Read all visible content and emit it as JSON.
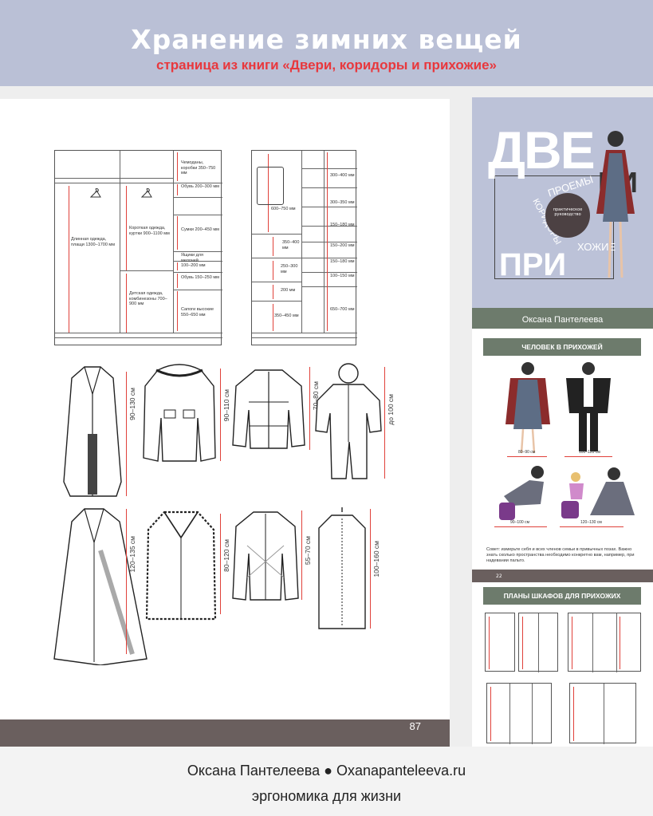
{
  "header": {
    "title": "Хранение зимних вещей",
    "subtitle": "страница из книги «Двери, коридоры и прихожие»"
  },
  "main_page": {
    "page_number": "87",
    "wardrobe_left": {
      "labels": [
        "Длинная одежда, плащи 1300–1700 мм",
        "Короткая одежда, куртки 900–1100 мм",
        "Детская одежда, комбинезоны 700–900 мм",
        "Чемоданы, коробки 350–750 мм",
        "Обувь 200–300 мм",
        "Сумки 200–450 мм",
        "Ящики для мелочей",
        "100–200 мм",
        "Обувь 150–250 мм",
        "Сапоги высокие 550–650 мм"
      ]
    },
    "wardrobe_right": {
      "labels": [
        "600–750 мм",
        "350–400 мм",
        "250–300 мм",
        "200 мм",
        "350–450 мм",
        "300–400 мм",
        "300–350 мм",
        "150–180 мм",
        "150–200 мм",
        "150–180 мм",
        "100–150 мм",
        "650–700 мм"
      ]
    },
    "garments": [
      {
        "name": "long-coat",
        "dimension": "90–130 см"
      },
      {
        "name": "parka",
        "dimension": "90–110 см"
      },
      {
        "name": "down-jacket",
        "dimension": "70–80 см"
      },
      {
        "name": "kids-overall",
        "dimension": "до 100 см"
      },
      {
        "name": "trench-coat",
        "dimension": "120–135 см"
      },
      {
        "name": "fur-coat",
        "dimension": "80–120 см"
      },
      {
        "name": "quilted-jacket",
        "dimension": "55–70 см"
      },
      {
        "name": "garment-bag",
        "dimension": "100–160 см"
      }
    ]
  },
  "cover": {
    "title_part1": "ДВЕ",
    "title_part2": "РИ",
    "title_part3": "ПРИ",
    "word_proemy": "ПРОЕМЫ",
    "word_koridory": "КОРИДОРЫ",
    "word_khozhie": "ХОЖИЕ",
    "guide": "практическое руководство",
    "author": "Оксана Пантелеева"
  },
  "page2": {
    "banner": "ЧЕЛОВЕК В ПРИХОЖЕЙ",
    "dims": [
      "80–90 см",
      "100–120 см",
      "90–100 см",
      "120–130 см"
    ],
    "note": "Совет: измерьте себя и всех членов семьи в привычных позах. Важно знать сколько пространства необходимо конкретно вам, например, при надевании пальто.",
    "page_number": "22"
  },
  "page3": {
    "banner": "ПЛАНЫ ШКАФОВ ДЛЯ ПРИХОЖИХ"
  },
  "footer": {
    "line1": "Оксана Пантелеева ● Oxanapanteleeva.ru",
    "line2": "эргономика для жизни"
  },
  "colors": {
    "header_bg": "#bac0d6",
    "accent_red": "#e8383d",
    "bar_brown": "#6a5f5e",
    "bar_green": "#6d7b6c"
  }
}
